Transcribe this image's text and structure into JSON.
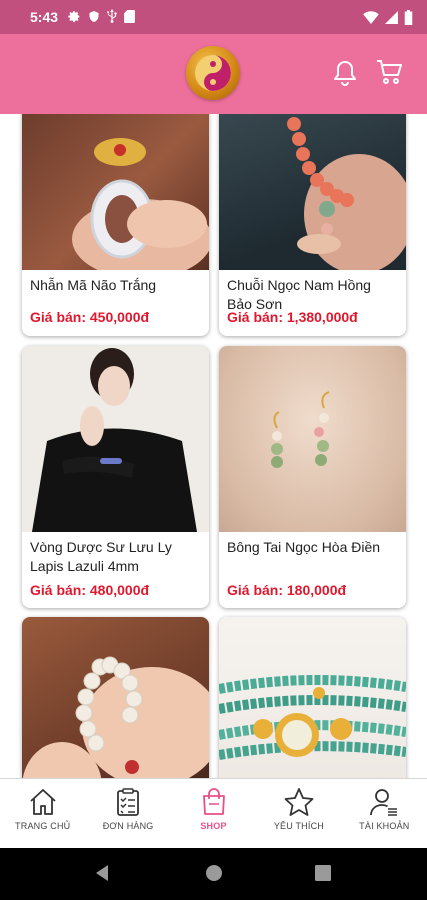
{
  "status_bar": {
    "time": "5:43",
    "left_icons": [
      "gear-icon",
      "shield-icon",
      "usb-icon",
      "sd-card-icon"
    ],
    "right_icons": [
      "wifi-icon",
      "signal-icon",
      "battery-icon"
    ]
  },
  "header": {
    "logo": "taiji-logo",
    "icons": [
      "bell-icon",
      "cart-icon"
    ],
    "background": "#ec6f9c"
  },
  "products": [
    {
      "name": "Nhẫn Mã Não Trắng",
      "price": "Giá bán: 450,000đ"
    },
    {
      "name": "Chuỗi Ngọc Nam Hồng Bảo Sơn",
      "price": "Giá bán: 1,380,000đ"
    },
    {
      "name": "Vòng Dược Sư Lưu Ly Lapis Lazuli 4mm",
      "price": "Giá bán: 480,000đ"
    },
    {
      "name": "Bông Tai Ngọc Hòa Điền",
      "price": "Giá bán: 180,000đ"
    },
    {
      "name": "",
      "price": ""
    },
    {
      "name": "",
      "price": ""
    }
  ],
  "bottom_nav": {
    "items": [
      {
        "label": "TRANG CHỦ",
        "icon": "home-icon",
        "active": false
      },
      {
        "label": "ĐƠN HÀNG",
        "icon": "clipboard-icon",
        "active": false
      },
      {
        "label": "SHOP",
        "icon": "shopping-bag-icon",
        "active": true
      },
      {
        "label": "YÊU THÍCH",
        "icon": "star-icon",
        "active": false
      },
      {
        "label": "TÀI KHOẢN",
        "icon": "account-icon",
        "active": false
      }
    ]
  },
  "colors": {
    "accent": "#ec6f9c",
    "status_bar": "#c2507f",
    "price": "#e0182e",
    "active_nav": "#e8508a"
  }
}
